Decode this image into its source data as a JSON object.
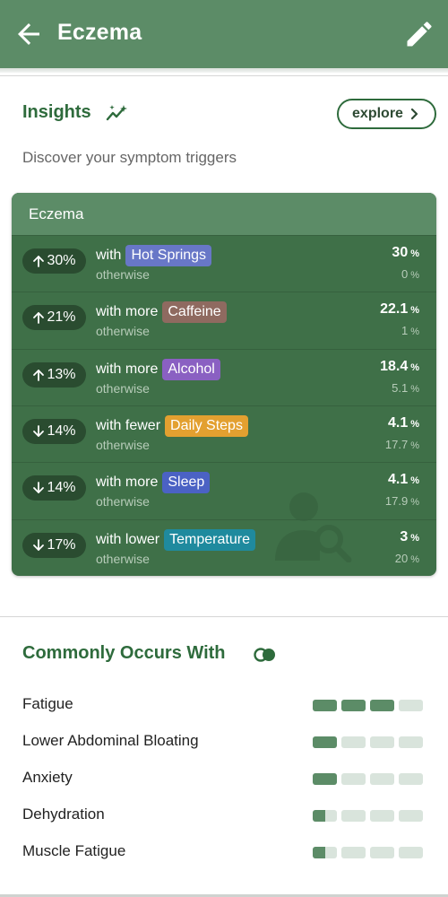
{
  "header": {
    "title": "Eczema",
    "back_icon": "arrow-left-icon",
    "edit_icon": "pencil-icon",
    "bg_color": "#5c8c67"
  },
  "insights": {
    "title": "Insights",
    "icon": "trend-sparkle-icon",
    "explore_label": "explore",
    "subtitle": "Discover your symptom triggers",
    "card": {
      "title": "Eczema",
      "rows": [
        {
          "direction": "up",
          "change": "30%",
          "lead": "with",
          "factor": "Hot Springs",
          "factor_color": "#6877c7",
          "value": "30",
          "unit": "%",
          "other_label": "otherwise",
          "other_value": "0",
          "other_unit": "%"
        },
        {
          "direction": "up",
          "change": "21%",
          "lead": "with more",
          "factor": "Caffeine",
          "factor_color": "#8f6a60",
          "value": "22.1",
          "unit": "%",
          "other_label": "otherwise",
          "other_value": "1",
          "other_unit": "%"
        },
        {
          "direction": "up",
          "change": "13%",
          "lead": "with more",
          "factor": "Alcohol",
          "factor_color": "#8a60c2",
          "value": "18.4",
          "unit": "%",
          "other_label": "otherwise",
          "other_value": "5.1",
          "other_unit": "%"
        },
        {
          "direction": "down",
          "change": "14%",
          "lead": "with fewer",
          "factor": "Daily Steps",
          "factor_color": "#e3a030",
          "value": "4.1",
          "unit": "%",
          "other_label": "otherwise",
          "other_value": "17.7",
          "other_unit": "%"
        },
        {
          "direction": "down",
          "change": "14%",
          "lead": "with more",
          "factor": "Sleep",
          "factor_color": "#4b62c4",
          "value": "4.1",
          "unit": "%",
          "other_label": "otherwise",
          "other_value": "17.9",
          "other_unit": "%"
        },
        {
          "direction": "down",
          "change": "17%",
          "lead": "with lower",
          "factor": "Temperature",
          "factor_color": "#1f8a9e",
          "value": "3",
          "unit": "%",
          "other_label": "otherwise",
          "other_value": "20",
          "other_unit": "%"
        }
      ]
    }
  },
  "commonly": {
    "title": "Commonly Occurs With",
    "icon": "overlap-circles-icon",
    "items": [
      {
        "label": "Fatigue",
        "level": 3,
        "of": 4
      },
      {
        "label": "Lower Abdominal Bloating",
        "level": 1,
        "of": 4
      },
      {
        "label": "Anxiety",
        "level": 1,
        "of": 4
      },
      {
        "label": "Dehydration",
        "level": 0.5,
        "of": 4
      },
      {
        "label": "Muscle Fatigue",
        "level": 0.5,
        "of": 4
      }
    ]
  }
}
